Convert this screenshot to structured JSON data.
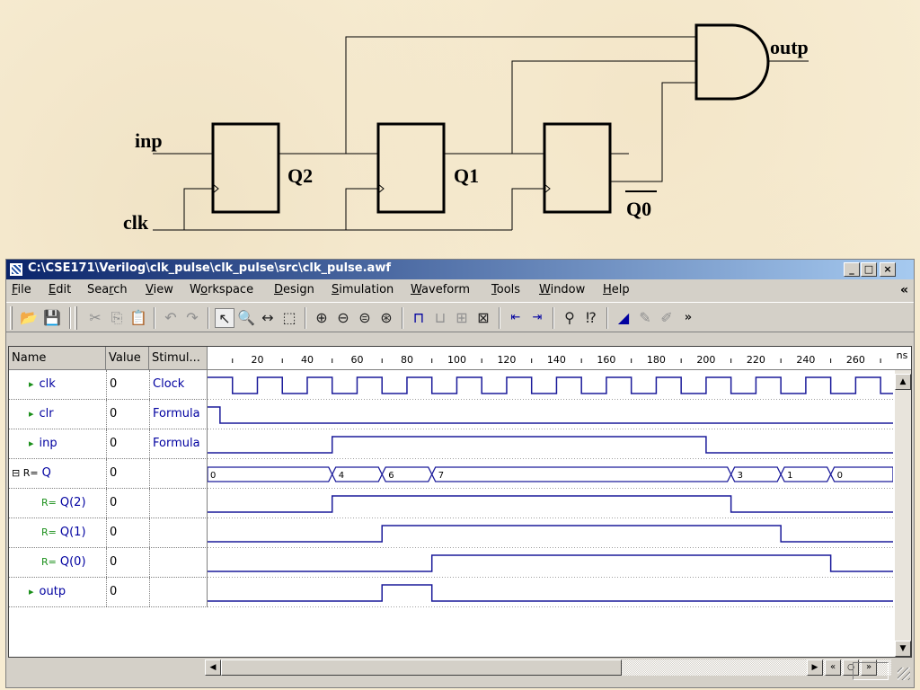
{
  "schematic": {
    "labels": {
      "inp": "inp",
      "clk": "clk",
      "q2": "Q2",
      "q1": "Q1",
      "q0": "Q0",
      "outp": "outp"
    }
  },
  "window": {
    "title": "C:\\CSE171\\Verilog\\clk_pulse\\clk_pulse\\src\\clk_pulse.awf",
    "buttons": {
      "minimize": "_",
      "maximize": "□",
      "close": "×"
    }
  },
  "menu": {
    "items": [
      {
        "u": "F",
        "rest": "ile"
      },
      {
        "u": "E",
        "rest": "dit"
      },
      {
        "pre": "Sea",
        "u": "r",
        "rest": "ch"
      },
      {
        "u": "V",
        "rest": "iew"
      },
      {
        "pre": "W",
        "u": "o",
        "rest": "rkspace"
      },
      {
        "u": "D",
        "rest": "esign"
      },
      {
        "u": "S",
        "rest": "imulation"
      },
      {
        "u": "W",
        "rest": "aveform"
      },
      {
        "u": "T",
        "rest": "ools"
      },
      {
        "u": "W",
        "rest": "indow"
      },
      {
        "u": "H",
        "rest": "elp"
      }
    ],
    "chevron": "«"
  },
  "toolbar": {
    "icons": [
      "open-folder-icon",
      "save-icon",
      "cut-icon",
      "copy-icon",
      "paste-icon",
      "undo-icon",
      "redo-icon",
      "pointer-icon",
      "zoom-icon",
      "measure-icon",
      "select-icon",
      "zoom-in-icon",
      "zoom-out-icon",
      "zoom-range-icon",
      "zoom-fit-icon",
      "add-signal-icon",
      "remove-signal-icon",
      "group-icon",
      "stimulator-icon",
      "bus-left-icon",
      "bus-right-icon",
      "find-icon",
      "find-next-icon",
      "marker-icon",
      "clear-marker-icon",
      "clear-all-icon"
    ],
    "overflow": "»"
  },
  "panel": {
    "headers": {
      "name": "Name",
      "value": "Value",
      "stimulus": "Stimul..."
    },
    "ruler": {
      "labels": [
        "20",
        "40",
        "60",
        "80",
        "100",
        "120",
        "140",
        "160",
        "180",
        "200",
        "220",
        "240",
        "260"
      ],
      "units": "ns",
      "range_ns": [
        0,
        275
      ]
    },
    "signals": [
      {
        "name": "clk",
        "value": "0",
        "stimulus": "Clock",
        "kind": "input"
      },
      {
        "name": "clr",
        "value": "0",
        "stimulus": "Formula",
        "kind": "input"
      },
      {
        "name": "inp",
        "value": "0",
        "stimulus": "Formula",
        "kind": "input"
      },
      {
        "name": "Q",
        "value": "0",
        "stimulus": "",
        "kind": "bus"
      },
      {
        "name": "Q(2)",
        "value": "0",
        "stimulus": "",
        "kind": "reg"
      },
      {
        "name": "Q(1)",
        "value": "0",
        "stimulus": "",
        "kind": "reg"
      },
      {
        "name": "Q(0)",
        "value": "0",
        "stimulus": "",
        "kind": "reg"
      },
      {
        "name": "outp",
        "value": "0",
        "stimulus": "",
        "kind": "output"
      }
    ]
  },
  "waves": {
    "clk": {
      "start": 1,
      "edges": [
        10,
        20,
        30,
        40,
        50,
        60,
        70,
        80,
        90,
        100,
        110,
        120,
        130,
        140,
        150,
        160,
        170,
        180,
        190,
        200,
        210,
        220,
        230,
        240,
        250,
        260,
        270
      ]
    },
    "clr": {
      "start": 1,
      "edges": [
        5
      ]
    },
    "inp": {
      "start": 0,
      "edges": [
        50,
        200
      ]
    },
    "Q2": {
      "start": 0,
      "edges": [
        50,
        210
      ]
    },
    "Q1": {
      "start": 0,
      "edges": [
        70,
        230
      ]
    },
    "Q0": {
      "start": 0,
      "edges": [
        90,
        250
      ]
    },
    "outp": {
      "start": 0,
      "edges": [
        70,
        90
      ]
    },
    "Q_bus": [
      {
        "t": 0,
        "label": "0"
      },
      {
        "t": 50,
        "label": "4"
      },
      {
        "t": 70,
        "label": "6"
      },
      {
        "t": 90,
        "label": "7"
      },
      {
        "t": 210,
        "label": "3"
      },
      {
        "t": 230,
        "label": "1"
      },
      {
        "t": 250,
        "label": "0"
      }
    ]
  }
}
